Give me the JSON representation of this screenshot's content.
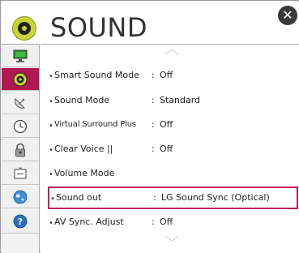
{
  "header": {
    "title": "SOUND",
    "close_label": "✕"
  },
  "colors": {
    "accent": "#c21c5e",
    "selected_tab": "#b0184f",
    "header_icon": "#c8d633"
  },
  "sidebar": {
    "items": [
      {
        "icon": "monitor-icon",
        "selected": false
      },
      {
        "icon": "speaker-icon",
        "selected": true
      },
      {
        "icon": "satellite-dish-icon",
        "selected": false
      },
      {
        "icon": "clock-icon",
        "selected": false
      },
      {
        "icon": "lock-icon",
        "selected": false
      },
      {
        "icon": "input-icon",
        "selected": false
      },
      {
        "icon": "globe-icon",
        "selected": false
      },
      {
        "icon": "help-icon",
        "selected": false
      }
    ]
  },
  "menu": {
    "items": [
      {
        "label": "Smart Sound Mode",
        "value": "Off"
      },
      {
        "label": "Sound Mode",
        "value": "Standard"
      },
      {
        "label": "Virtual Surround Plus",
        "value": "Off"
      },
      {
        "label": "Clear Voice ||",
        "value": "Off"
      },
      {
        "label": "Volume Mode",
        "value": ""
      },
      {
        "label": "Sound out",
        "value": "LG Sound Sync (Optical)"
      },
      {
        "label": "AV Sync. Adjust",
        "value": "Off"
      }
    ],
    "colon": ":",
    "bullet": "•"
  }
}
